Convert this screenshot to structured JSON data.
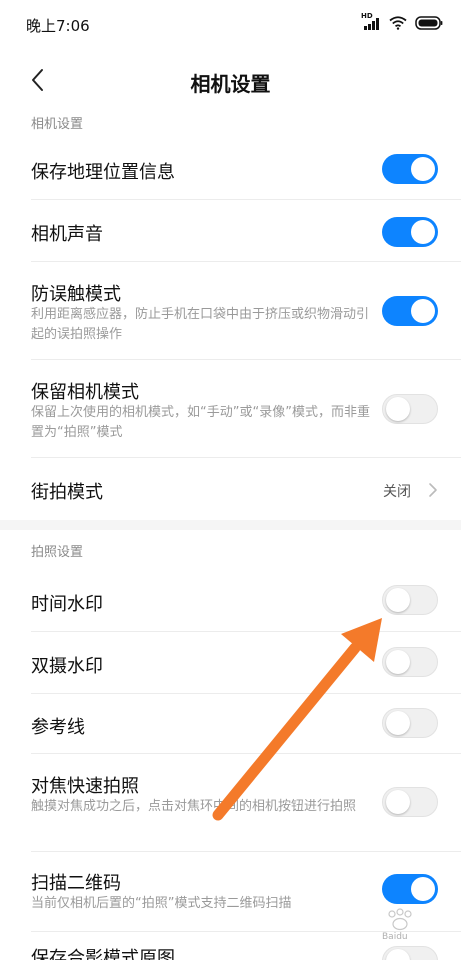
{
  "status_bar": {
    "time": "晚上7:06",
    "hd_label": "HD",
    "icons": [
      "signal-icon",
      "wifi-icon",
      "battery-icon"
    ]
  },
  "header": {
    "title": "相机设置",
    "back_icon": "chevron-left-icon"
  },
  "sections": [
    {
      "header": "相机设置",
      "items": [
        {
          "title": "保存地理位置信息",
          "desc": "",
          "toggle": true
        },
        {
          "title": "相机声音",
          "desc": "",
          "toggle": true
        },
        {
          "title": "防误触模式",
          "desc": "利用距离感应器，防止手机在口袋中由于挤压或织物滑动引起的误拍照操作",
          "toggle": true
        },
        {
          "title": "保留相机模式",
          "desc": "保留上次使用的相机模式，如“手动”或“录像”模式，而非重置为“拍照”模式",
          "toggle": false
        },
        {
          "title": "街拍模式",
          "value": "关闭"
        }
      ]
    },
    {
      "header": "拍照设置",
      "items": [
        {
          "title": "时间水印",
          "desc": "",
          "toggle": false
        },
        {
          "title": "双摄水印",
          "desc": "",
          "toggle": false
        },
        {
          "title": "参考线",
          "desc": "",
          "toggle": false
        },
        {
          "title": "对焦快速拍照",
          "desc": "触摸对焦成功之后，点击对焦环中间的相机按钮进行拍照",
          "toggle": false
        },
        {
          "title": "扫描二维码",
          "desc": "当前仅相机后置的“拍照”模式支持二维码扫描",
          "toggle": true
        },
        {
          "title": "保存合影模式原图",
          "desc": "",
          "toggle": false
        }
      ]
    }
  ],
  "colors": {
    "toggle_on": "#0d84ff",
    "toggle_off": "#f0f0f0",
    "annotation_arrow": "#f47a2a"
  },
  "watermark": {
    "icon": "baidu-paw-icon",
    "text": "Baidu"
  }
}
